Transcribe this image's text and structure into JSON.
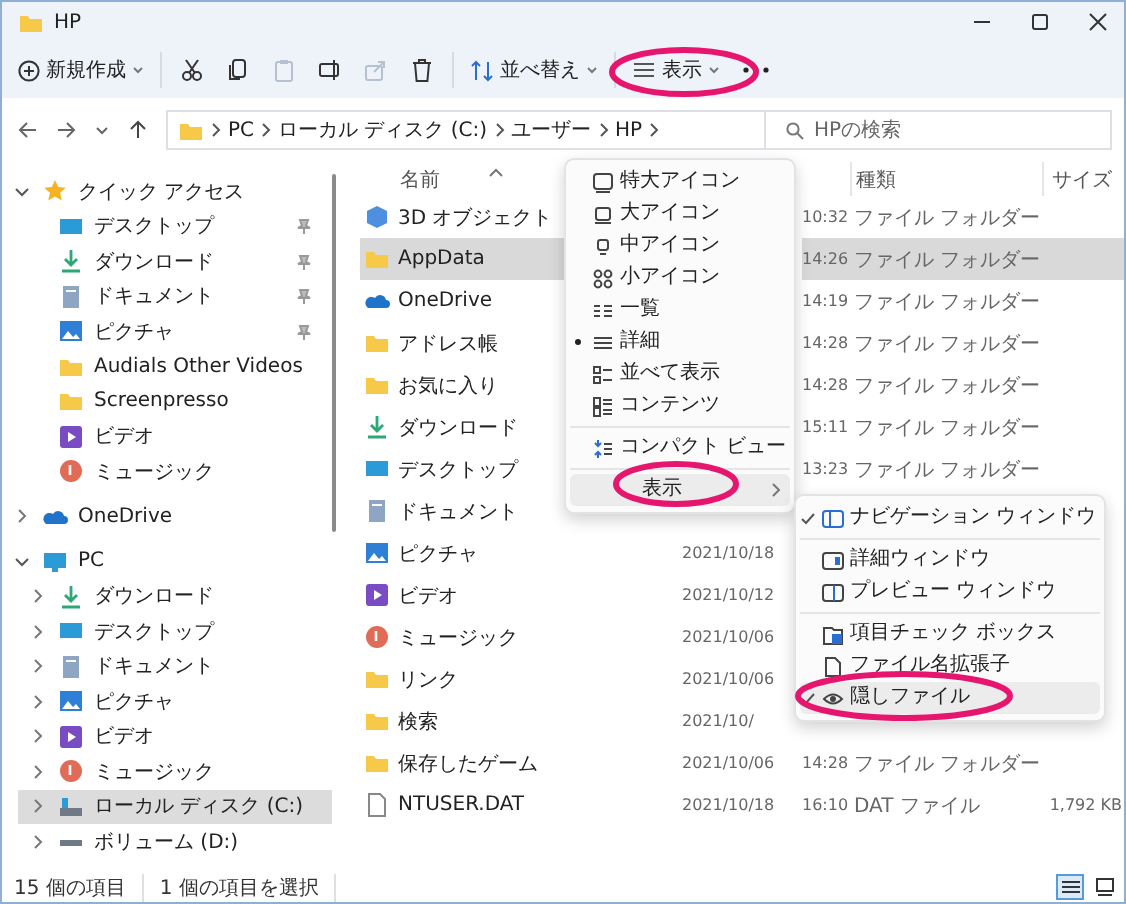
{
  "window": {
    "title": "HP"
  },
  "toolbar": {
    "new_label": "新規作成",
    "actions": [
      {
        "kind": "cut",
        "disabled": false
      },
      {
        "kind": "copy",
        "disabled": false
      },
      {
        "kind": "paste",
        "disabled": true
      },
      {
        "kind": "rename",
        "disabled": false
      },
      {
        "kind": "share",
        "disabled": true
      },
      {
        "kind": "delete",
        "disabled": false
      }
    ],
    "sort_label": "並べ替え",
    "view": {
      "label": "表示",
      "circled": true
    }
  },
  "address": {
    "crumbs": [
      "PC",
      "ローカル ディスク (C:)",
      "ユーザー",
      "HP"
    ],
    "search_placeholder": "HPの検索"
  },
  "nav": [
    {
      "label": "クイック アクセス",
      "kind": "star",
      "expanded": true,
      "selected": false,
      "children": [
        {
          "label": "デスクトップ",
          "kind": "desktop",
          "pinned": true,
          "selected": false
        },
        {
          "label": "ダウンロード",
          "kind": "download",
          "pinned": true,
          "selected": false
        },
        {
          "label": "ドキュメント",
          "kind": "document",
          "pinned": true,
          "selected": false
        },
        {
          "label": "ピクチャ",
          "kind": "picture",
          "pinned": true,
          "selected": false
        },
        {
          "label": "Audials Other Videos",
          "kind": "folder",
          "pinned": false,
          "selected": false
        },
        {
          "label": "Screenpresso",
          "kind": "folder",
          "pinned": false,
          "selected": false
        },
        {
          "label": "ビデオ",
          "kind": "video",
          "pinned": false,
          "selected": false
        },
        {
          "label": "ミュージック",
          "kind": "music",
          "pinned": false,
          "selected": false
        }
      ]
    },
    {
      "label": "OneDrive",
      "kind": "onedrive",
      "expanded": false,
      "selected": false
    },
    {
      "label": "PC",
      "kind": "pc",
      "expanded": true,
      "selected": false,
      "children": [
        {
          "label": "ダウンロード",
          "kind": "download",
          "expanded": false,
          "selected": false
        },
        {
          "label": "デスクトップ",
          "kind": "desktop",
          "expanded": false,
          "selected": false
        },
        {
          "label": "ドキュメント",
          "kind": "document",
          "expanded": false,
          "selected": false
        },
        {
          "label": "ピクチャ",
          "kind": "picture",
          "expanded": false,
          "selected": false
        },
        {
          "label": "ビデオ",
          "kind": "video",
          "expanded": false,
          "selected": false
        },
        {
          "label": "ミュージック",
          "kind": "music",
          "expanded": false,
          "selected": false
        },
        {
          "label": "ローカル ディスク (C:)",
          "kind": "drive",
          "expanded": false,
          "selected": true
        },
        {
          "label": "ボリューム (D:)",
          "kind": "volume",
          "expanded": false,
          "selected": false
        }
      ]
    }
  ],
  "table": {
    "columns": [
      {
        "kind": "name",
        "label": "名前"
      },
      {
        "kind": "date"
      },
      {
        "kind": "type",
        "label": "種類"
      },
      {
        "kind": "size",
        "label": "サイズ"
      }
    ],
    "rows": [
      {
        "name": "3D オブジェクト",
        "kind": "cube",
        "time": "10:32",
        "type": "ファイル フォルダー",
        "selected": false
      },
      {
        "name": "AppData",
        "kind": "folder",
        "time": "14:26",
        "type": "ファイル フォルダー",
        "selected": true
      },
      {
        "name": "OneDrive",
        "kind": "onedrive",
        "time": "14:19",
        "type": "ファイル フォルダー",
        "selected": false
      },
      {
        "name": "アドレス帳",
        "kind": "folder",
        "time": "14:28",
        "type": "ファイル フォルダー",
        "selected": false
      },
      {
        "name": "お気に入り",
        "kind": "folder",
        "time": "14:28",
        "type": "ファイル フォルダー",
        "selected": false
      },
      {
        "name": "ダウンロード",
        "kind": "download",
        "time": "15:11",
        "type": "ファイル フォルダー",
        "selected": false
      },
      {
        "name": "デスクトップ",
        "kind": "desktop",
        "time": "13:23",
        "type": "ファイル フォルダー",
        "selected": false
      },
      {
        "name": "ドキュメント",
        "kind": "document",
        "selected": false
      },
      {
        "name": "ピクチャ",
        "kind": "picture",
        "date": "2021/10/18",
        "selected": false
      },
      {
        "name": "ビデオ",
        "kind": "video",
        "date": "2021/10/12",
        "selected": false
      },
      {
        "name": "ミュージック",
        "kind": "music",
        "date": "2021/10/06",
        "selected": false
      },
      {
        "name": "リンク",
        "kind": "folder",
        "date": "2021/10/06",
        "selected": false
      },
      {
        "name": "検索",
        "kind": "folder",
        "date": "2021/10/",
        "selected": false
      },
      {
        "name": "保存したゲーム",
        "kind": "folder",
        "date": "2021/10/06",
        "time": "14:28",
        "type": "ファイル フォルダー",
        "selected": false
      },
      {
        "name": "NTUSER.DAT",
        "kind": "file",
        "date": "2021/10/18",
        "time": "16:10",
        "type": "DAT ファイル",
        "size": "1,792 KB",
        "selected": false
      }
    ]
  },
  "view_menu": {
    "layouts": [
      {
        "label": "特大アイコン",
        "kind": "xl",
        "selected": false
      },
      {
        "label": "大アイコン",
        "kind": "large",
        "selected": false
      },
      {
        "label": "中アイコン",
        "kind": "medium",
        "selected": false
      },
      {
        "label": "小アイコン",
        "kind": "small",
        "selected": false
      },
      {
        "label": "一覧",
        "kind": "list",
        "selected": false
      },
      {
        "label": "詳細",
        "kind": "details",
        "selected": true
      },
      {
        "label": "並べて表示",
        "kind": "tiles",
        "selected": false
      },
      {
        "label": "コンテンツ",
        "kind": "content",
        "selected": false
      }
    ],
    "compact": {
      "label": "コンパクト ビュー"
    },
    "show": {
      "label": "表示",
      "highlighted": true,
      "circled": true
    }
  },
  "show_menu": [
    {
      "label": "ナビゲーション ウィンドウ",
      "kind": "navpane",
      "checked": true,
      "highlighted": false,
      "circled": false
    },
    {
      "label": "詳細ウィンドウ",
      "kind": "detailspane",
      "checked": false,
      "highlighted": false,
      "circled": false
    },
    {
      "label": "プレビュー ウィンドウ",
      "kind": "previewpane",
      "checked": false,
      "highlighted": false,
      "circled": false
    },
    {
      "label": "項目チェック ボックス",
      "kind": "checkboxes",
      "checked": false,
      "highlighted": false,
      "circled": false
    },
    {
      "label": "ファイル名拡張子",
      "kind": "extensions",
      "checked": false,
      "highlighted": false,
      "circled": false
    },
    {
      "label": "隠しファイル",
      "kind": "hidden",
      "checked": true,
      "highlighted": true,
      "circled": true
    }
  ],
  "status_bar": {
    "items": [
      "15 個の項目",
      "1 個の項目を選択"
    ],
    "views": [
      {
        "kind": "details",
        "selected": true
      },
      {
        "kind": "tiles",
        "selected": false
      }
    ]
  }
}
